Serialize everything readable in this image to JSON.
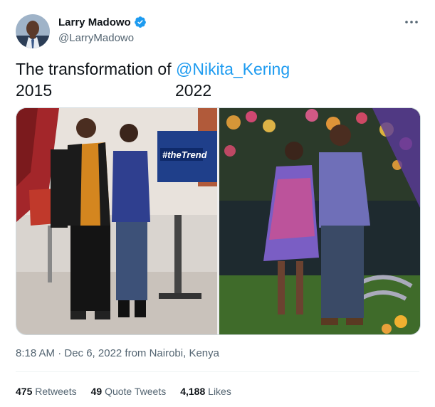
{
  "author": {
    "name": "Larry Madowo",
    "handle": "@LarryMadowo",
    "verified": true,
    "verified_color": "#1d9bf0"
  },
  "tweet": {
    "text_prefix": "The transformation of ",
    "mention": "@Nikita_Kering",
    "caption_left": "2015",
    "caption_right": "2022"
  },
  "media": {
    "left_overlay_text": "#theTrend"
  },
  "meta": {
    "timestamp": "8:18 AM · Dec 6, 2022 from Nairobi, Kenya"
  },
  "stats": {
    "retweets_count": "475",
    "retweets_label": "Retweets",
    "quotes_count": "49",
    "quotes_label": "Quote Tweets",
    "likes_count": "4,188",
    "likes_label": "Likes"
  },
  "icons": {
    "verified": "verified-badge-icon",
    "more": "more-options-icon"
  },
  "colors": {
    "link": "#1d9bf0",
    "text": "#0f1419",
    "secondary": "#536471"
  }
}
